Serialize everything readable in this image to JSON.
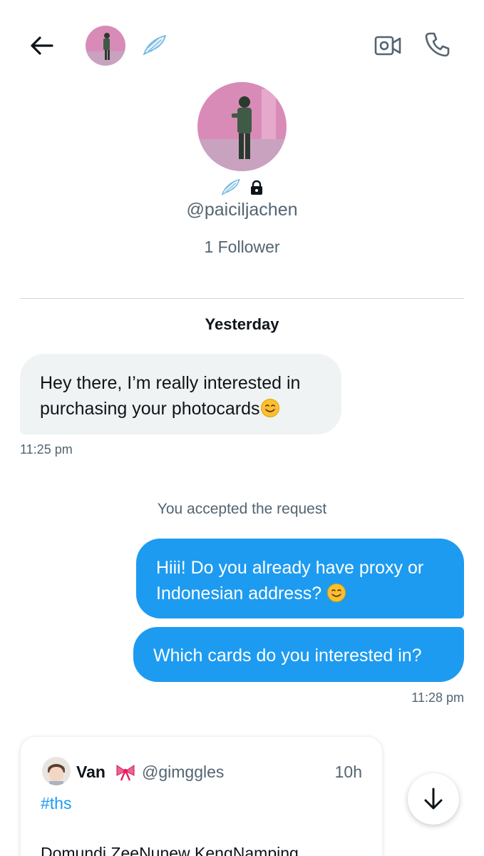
{
  "header": {
    "back_icon": "arrow-left-icon",
    "video_icon": "video-call-icon",
    "phone_icon": "phone-icon"
  },
  "profile": {
    "handle": "@paiciljachen",
    "followers": "1 Follower",
    "badges": [
      "wing-icon",
      "lock-icon"
    ]
  },
  "conversation": {
    "date_separator": "Yesterday",
    "incoming": [
      {
        "text": "Hey there, I’m really interested in purchasing your photocards",
        "emoji": "smiling-face-emoji",
        "time": "11:25 pm"
      }
    ],
    "system_notice": "You accepted the request",
    "outgoing": [
      {
        "text": "Hiii! Do you already have proxy or Indonesian address? ",
        "emoji": "smiling-face-emoji"
      },
      {
        "text": "Which cards do you interested in?"
      }
    ],
    "outgoing_time": "11:28 pm"
  },
  "quoted_tweet": {
    "name": "Van",
    "name_emoji": "ribbon-bow-icon",
    "username": "@gimggles",
    "time": "10h",
    "hashtag": "#ths",
    "text": "Domundi ZeeNunew KengNamping"
  },
  "scroll_button_icon": "arrow-down-icon",
  "colors": {
    "accent": "#1d9bf0",
    "incoming_bubble": "#eff3f4",
    "secondary_text": "#536471",
    "avatar_tint": "#d98bb8"
  }
}
